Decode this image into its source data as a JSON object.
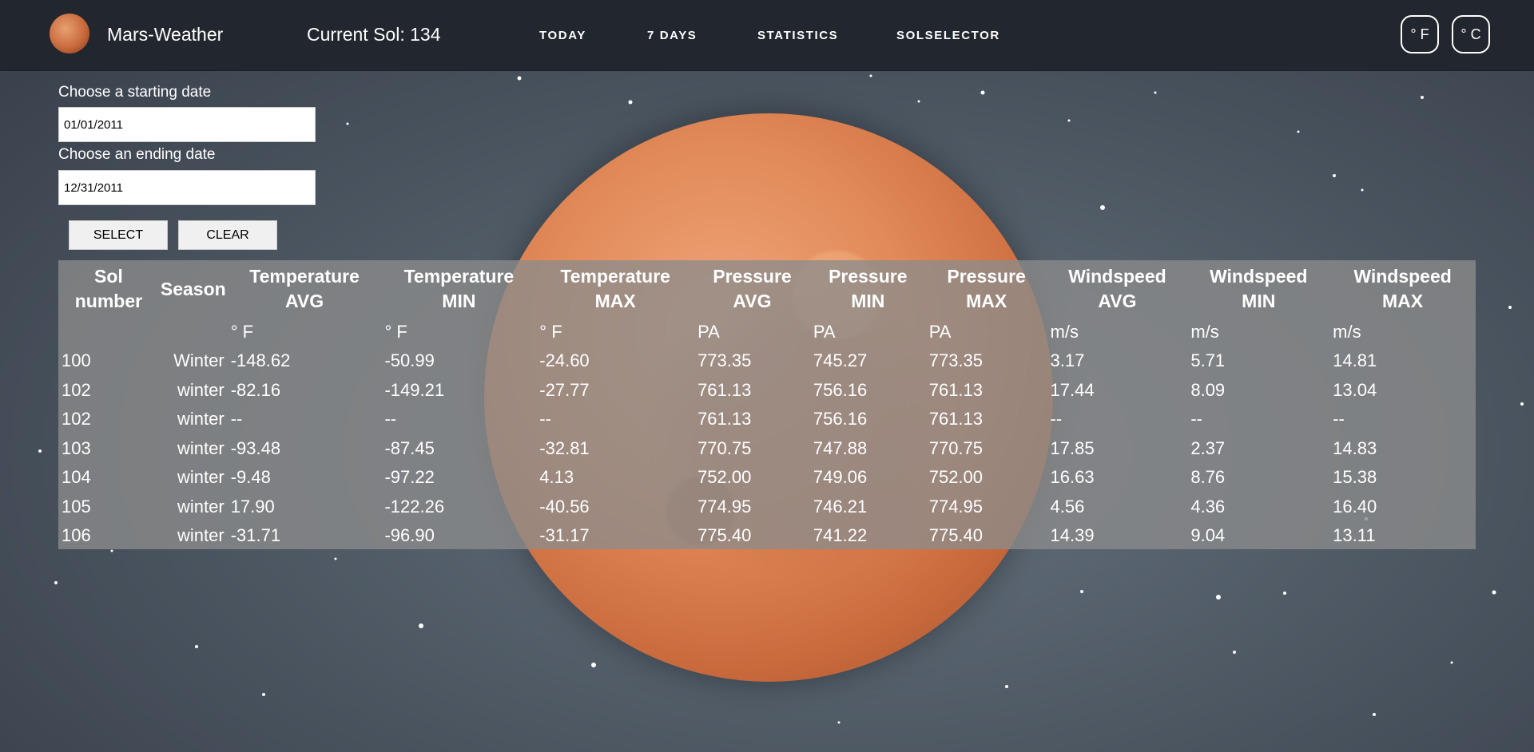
{
  "header": {
    "brand": "Mars-Weather",
    "current_sol": "Current Sol: 134",
    "nav": [
      "TODAY",
      "7 DAYS",
      "STATISTICS",
      "SOLSELECTOR"
    ],
    "unit_f": "° F",
    "unit_c": "° C"
  },
  "form": {
    "start_label": "Choose a starting date",
    "start_value": "01/01/2011",
    "end_label": "Choose an ending date",
    "end_value": "12/31/2011",
    "select_label": "SELECT",
    "clear_label": "CLEAR"
  },
  "table": {
    "headers": [
      [
        "Sol",
        "number"
      ],
      [
        "Season",
        ""
      ],
      [
        "Temperature",
        "AVG"
      ],
      [
        "Temperature",
        "MIN"
      ],
      [
        "Temperature",
        "MAX"
      ],
      [
        "Pressure",
        "AVG"
      ],
      [
        "Pressure",
        "MIN"
      ],
      [
        "Pressure",
        "MAX"
      ],
      [
        "Windspeed",
        "AVG"
      ],
      [
        "Windspeed",
        "MIN"
      ],
      [
        "Windspeed",
        "MAX"
      ]
    ],
    "units": [
      "",
      "",
      "° F",
      "° F",
      "° F",
      "PA",
      "PA",
      "PA",
      "m/s",
      "m/s",
      "m/s"
    ],
    "rows": [
      [
        "100",
        "Winter",
        "-148.62",
        "-50.99",
        "-24.60",
        "773.35",
        "745.27",
        "773.35",
        "3.17",
        "5.71",
        "14.81"
      ],
      [
        "102",
        "winter",
        "-82.16",
        "-149.21",
        "-27.77",
        "761.13",
        "756.16",
        "761.13",
        "17.44",
        "8.09",
        "13.04"
      ],
      [
        "102",
        "winter",
        "--",
        "--",
        "--",
        "761.13",
        "756.16",
        "761.13",
        "--",
        "--",
        "--"
      ],
      [
        "103",
        "winter",
        "-93.48",
        "-87.45",
        "-32.81",
        "770.75",
        "747.88",
        "770.75",
        "17.85",
        "2.37",
        "14.83"
      ],
      [
        "104",
        "winter",
        "-9.48",
        "-97.22",
        "4.13",
        "752.00",
        "749.06",
        "752.00",
        "16.63",
        "8.76",
        "15.38"
      ],
      [
        "105",
        "winter",
        "17.90",
        "-122.26",
        "-40.56",
        "774.95",
        "746.21",
        "774.95",
        "4.56",
        "4.36",
        "16.40"
      ],
      [
        "106",
        "winter",
        "-31.71",
        "-96.90",
        "-31.17",
        "775.40",
        "741.22",
        "775.40",
        "14.39",
        "9.04",
        "13.11"
      ]
    ]
  }
}
